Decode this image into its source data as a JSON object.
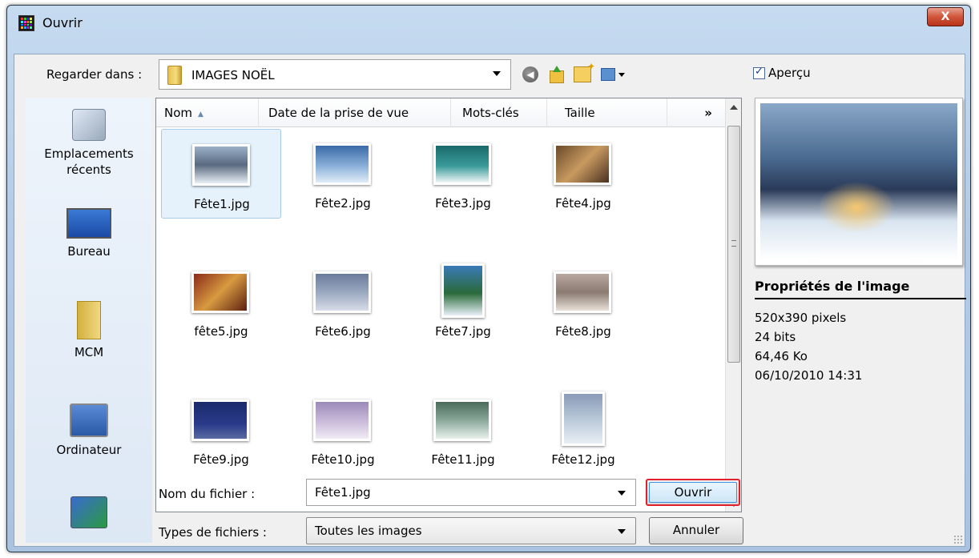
{
  "window": {
    "title": "Ouvrir",
    "close_label": "X"
  },
  "lookin": {
    "label": "Regarder dans :",
    "value": "IMAGES NOËL"
  },
  "preview": {
    "checkbox_label": "Aperçu"
  },
  "places": [
    {
      "label": "Emplacements récents",
      "icon": "recent-places-icon"
    },
    {
      "label": "Bureau",
      "icon": "desktop-icon"
    },
    {
      "label": "MCM",
      "icon": "user-folder-icon"
    },
    {
      "label": "Ordinateur",
      "icon": "computer-icon"
    },
    {
      "label": "",
      "icon": "network-icon"
    }
  ],
  "columns": {
    "name": "Nom",
    "date": "Date de la prise de vue",
    "tags": "Mots-clés",
    "size": "Taille",
    "more": "»"
  },
  "files": [
    {
      "name": "Fête1.jpg",
      "selected": true
    },
    {
      "name": "Fête2.jpg"
    },
    {
      "name": "Fête3.jpg"
    },
    {
      "name": "Fête4.jpg"
    },
    {
      "name": "fête5.jpg"
    },
    {
      "name": "Fête6.jpg"
    },
    {
      "name": "Fête7.jpg"
    },
    {
      "name": "Fête8.jpg"
    },
    {
      "name": "Fête9.jpg"
    },
    {
      "name": "Fête10.jpg"
    },
    {
      "name": "Fête11.jpg"
    },
    {
      "name": "Fête12.jpg"
    }
  ],
  "filename": {
    "label": "Nom du fichier :",
    "value": "Fête1.jpg"
  },
  "filetype": {
    "label": "Types de fichiers :",
    "value": "Toutes les images"
  },
  "buttons": {
    "open": "Ouvrir",
    "cancel": "Annuler"
  },
  "properties": {
    "title": "Propriétés de l'image",
    "dimensions": "520x390 pixels",
    "bits": "24 bits",
    "size": "64,46 Ko",
    "date": "06/10/2010 14:31"
  },
  "colors": {
    "selection": "#e5f1fb",
    "accent_border": "#e0202a",
    "title_bar": "#b3cbe6"
  }
}
